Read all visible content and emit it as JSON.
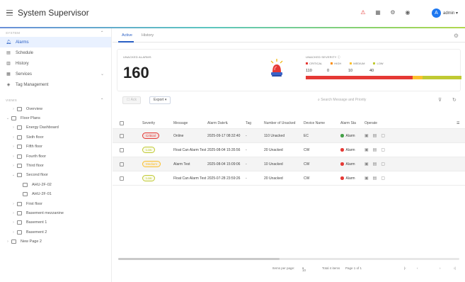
{
  "app": {
    "title": "System Supervisor",
    "user": "admin",
    "avatar_initial": "A"
  },
  "colors": {
    "accent": "#2a5fc4",
    "critical": "#e53935",
    "high": "#fb8c00",
    "medium": "#fbc02d",
    "low": "#c0ca33",
    "online": "#43a047"
  },
  "top_icons": [
    "alarm-bell-icon",
    "calendar-icon",
    "settings-icon",
    "language-icon"
  ],
  "sidebar": {
    "system_section": "SYSTEM",
    "items": [
      {
        "label": "Alarms",
        "icon": "bell-icon",
        "active": true
      },
      {
        "label": "Schedule",
        "icon": "schedule-icon"
      },
      {
        "label": "History",
        "icon": "history-icon"
      },
      {
        "label": "Services",
        "icon": "services-icon",
        "expandable": true
      },
      {
        "label": "Tag Management",
        "icon": "tag-icon"
      }
    ],
    "views_section": "VIEWS",
    "tree": [
      {
        "label": "Overview",
        "level": 1
      },
      {
        "label": "Floor Plans",
        "level": 0,
        "expanded": true
      },
      {
        "label": "Energy Dashboard",
        "level": 1
      },
      {
        "label": "Sixth floor",
        "level": 1
      },
      {
        "label": "Fifth floor",
        "level": 1
      },
      {
        "label": "Fourth floor",
        "level": 1
      },
      {
        "label": "Third floor",
        "level": 1
      },
      {
        "label": "Second floor",
        "level": 1,
        "expanded": true
      },
      {
        "label": "AHU-2F-02",
        "level": 2
      },
      {
        "label": "AHU-2F-01",
        "level": 2
      },
      {
        "label": "First floor",
        "level": 1
      },
      {
        "label": "Basement mezzanine",
        "level": 1
      },
      {
        "label": "Basement 1",
        "level": 1
      },
      {
        "label": "Basement 2",
        "level": 1
      },
      {
        "label": "New Page 2",
        "level": 0
      }
    ]
  },
  "tabs": [
    {
      "label": "Active",
      "active": true
    },
    {
      "label": "History"
    }
  ],
  "summary": {
    "unacked_label": "UNACKED ALARMS",
    "unacked_count": "160",
    "severity_label": "UNACKED SEVERITY",
    "severity": [
      {
        "name": "CRITICAL",
        "value": "110",
        "color": "#e53935",
        "fraction": 0.6875
      },
      {
        "name": "HIGH",
        "value": "0",
        "color": "#fb8c00",
        "fraction": 0.0
      },
      {
        "name": "MEDIUM",
        "value": "10",
        "color": "#fbc02d",
        "fraction": 0.0625
      },
      {
        "name": "LOW",
        "value": "40",
        "color": "#c0ca33",
        "fraction": 0.25
      }
    ]
  },
  "toolbar": {
    "ack_label": "Ack",
    "export_label": "Export",
    "search_placeholder": "Search Message and Priority"
  },
  "table": {
    "columns": [
      "Severity",
      "Message",
      "Alarm Date",
      "Tag",
      "Number of Unacked",
      "Device Name",
      "Alarm Sta",
      "Operate"
    ],
    "rows": [
      {
        "severity": "Critical",
        "severity_color": "#e53935",
        "message": "Online",
        "date": "2025-09-17 08:32:40",
        "tag": "-",
        "unacked": "110 Unacked",
        "device": "EC",
        "status": "Alarm",
        "status_color": "#43a047"
      },
      {
        "severity": "Low",
        "severity_color": "#c0ca33",
        "message": "Float Can Alarm Test",
        "date": "2025-08-04 15:35:56",
        "tag": "-",
        "unacked": "20 Unacked",
        "device": "CW",
        "status": "Alarm",
        "status_color": "#e53935"
      },
      {
        "severity": "Medium",
        "severity_color": "#fbc02d",
        "message": "Alarm Test",
        "date": "2025-08-04 15:09:06",
        "tag": "-",
        "unacked": "10 Unacked",
        "device": "CW",
        "status": "Alarm",
        "status_color": "#e53935"
      },
      {
        "severity": "Low",
        "severity_color": "#c0ca33",
        "message": "Float Can Alarm Test",
        "date": "2025-07-28 23:59:26",
        "tag": "-",
        "unacked": "20 Unacked",
        "device": "CW",
        "status": "Alarm",
        "status_color": "#e53935"
      }
    ]
  },
  "pager": {
    "items_per_page_label": "Items per page:",
    "page_size": "10",
    "total_label": "Total 4 items",
    "page_label": "Page 1 of 1"
  }
}
